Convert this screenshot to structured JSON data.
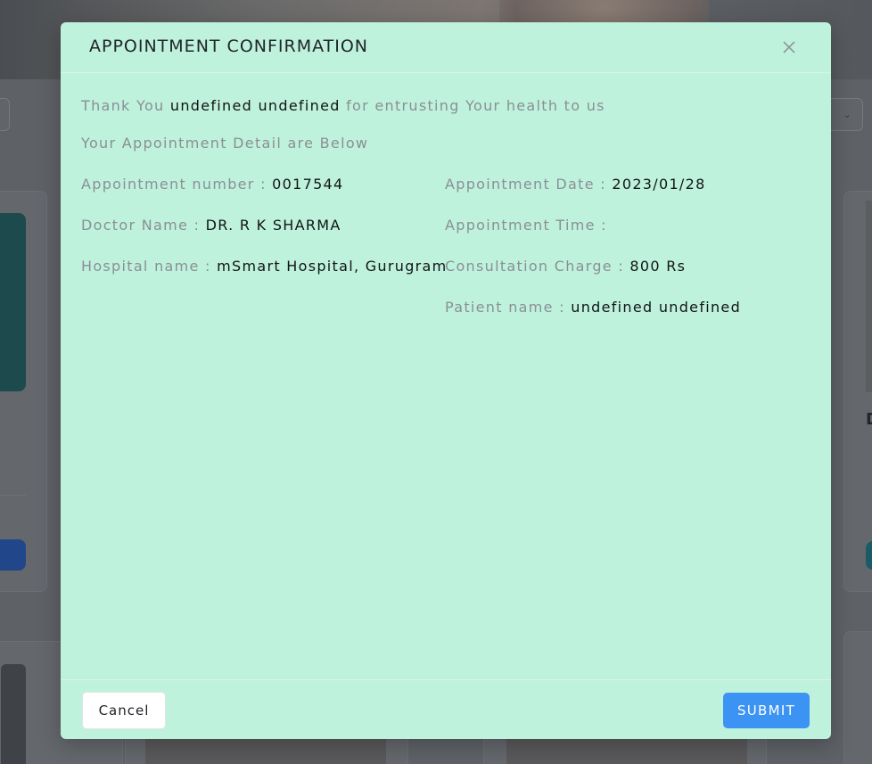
{
  "modal": {
    "title": "APPOINTMENT CONFIRMATION",
    "thank_prefix": "Thank You",
    "patient_full_name": "undefined undefined",
    "thank_suffix": "for entrusting Your health to us",
    "details_heading": "Your Appointment Detail are Below",
    "fields": {
      "appointment_number": {
        "label": "Appointment number :",
        "value": "0017544"
      },
      "doctor_name": {
        "label": "Doctor Name :",
        "value": "DR. R K SHARMA"
      },
      "hospital_name": {
        "label": "Hospital name :",
        "value": "mSmart Hospital, Gurugram"
      },
      "appointment_date": {
        "label": "Appointment Date :",
        "value": "2023/01/28"
      },
      "appointment_time": {
        "label": "Appointment Time :",
        "value": ""
      },
      "consultation_charge": {
        "label": "Consultation Charge :",
        "value": "800 Rs"
      },
      "patient_name": {
        "label": "Patient name :",
        "value": "undefined undefined"
      }
    },
    "buttons": {
      "cancel": "Cancel",
      "submit": "SUBMIT"
    },
    "close_icon": "close-icon"
  },
  "background": {
    "card_initial": "D"
  },
  "colors": {
    "modal_bg": "#bff2dc",
    "submit_bg": "#3b93f4",
    "label_text": "#8a8f96",
    "value_text": "#111418",
    "overlay": "#5e6166"
  }
}
